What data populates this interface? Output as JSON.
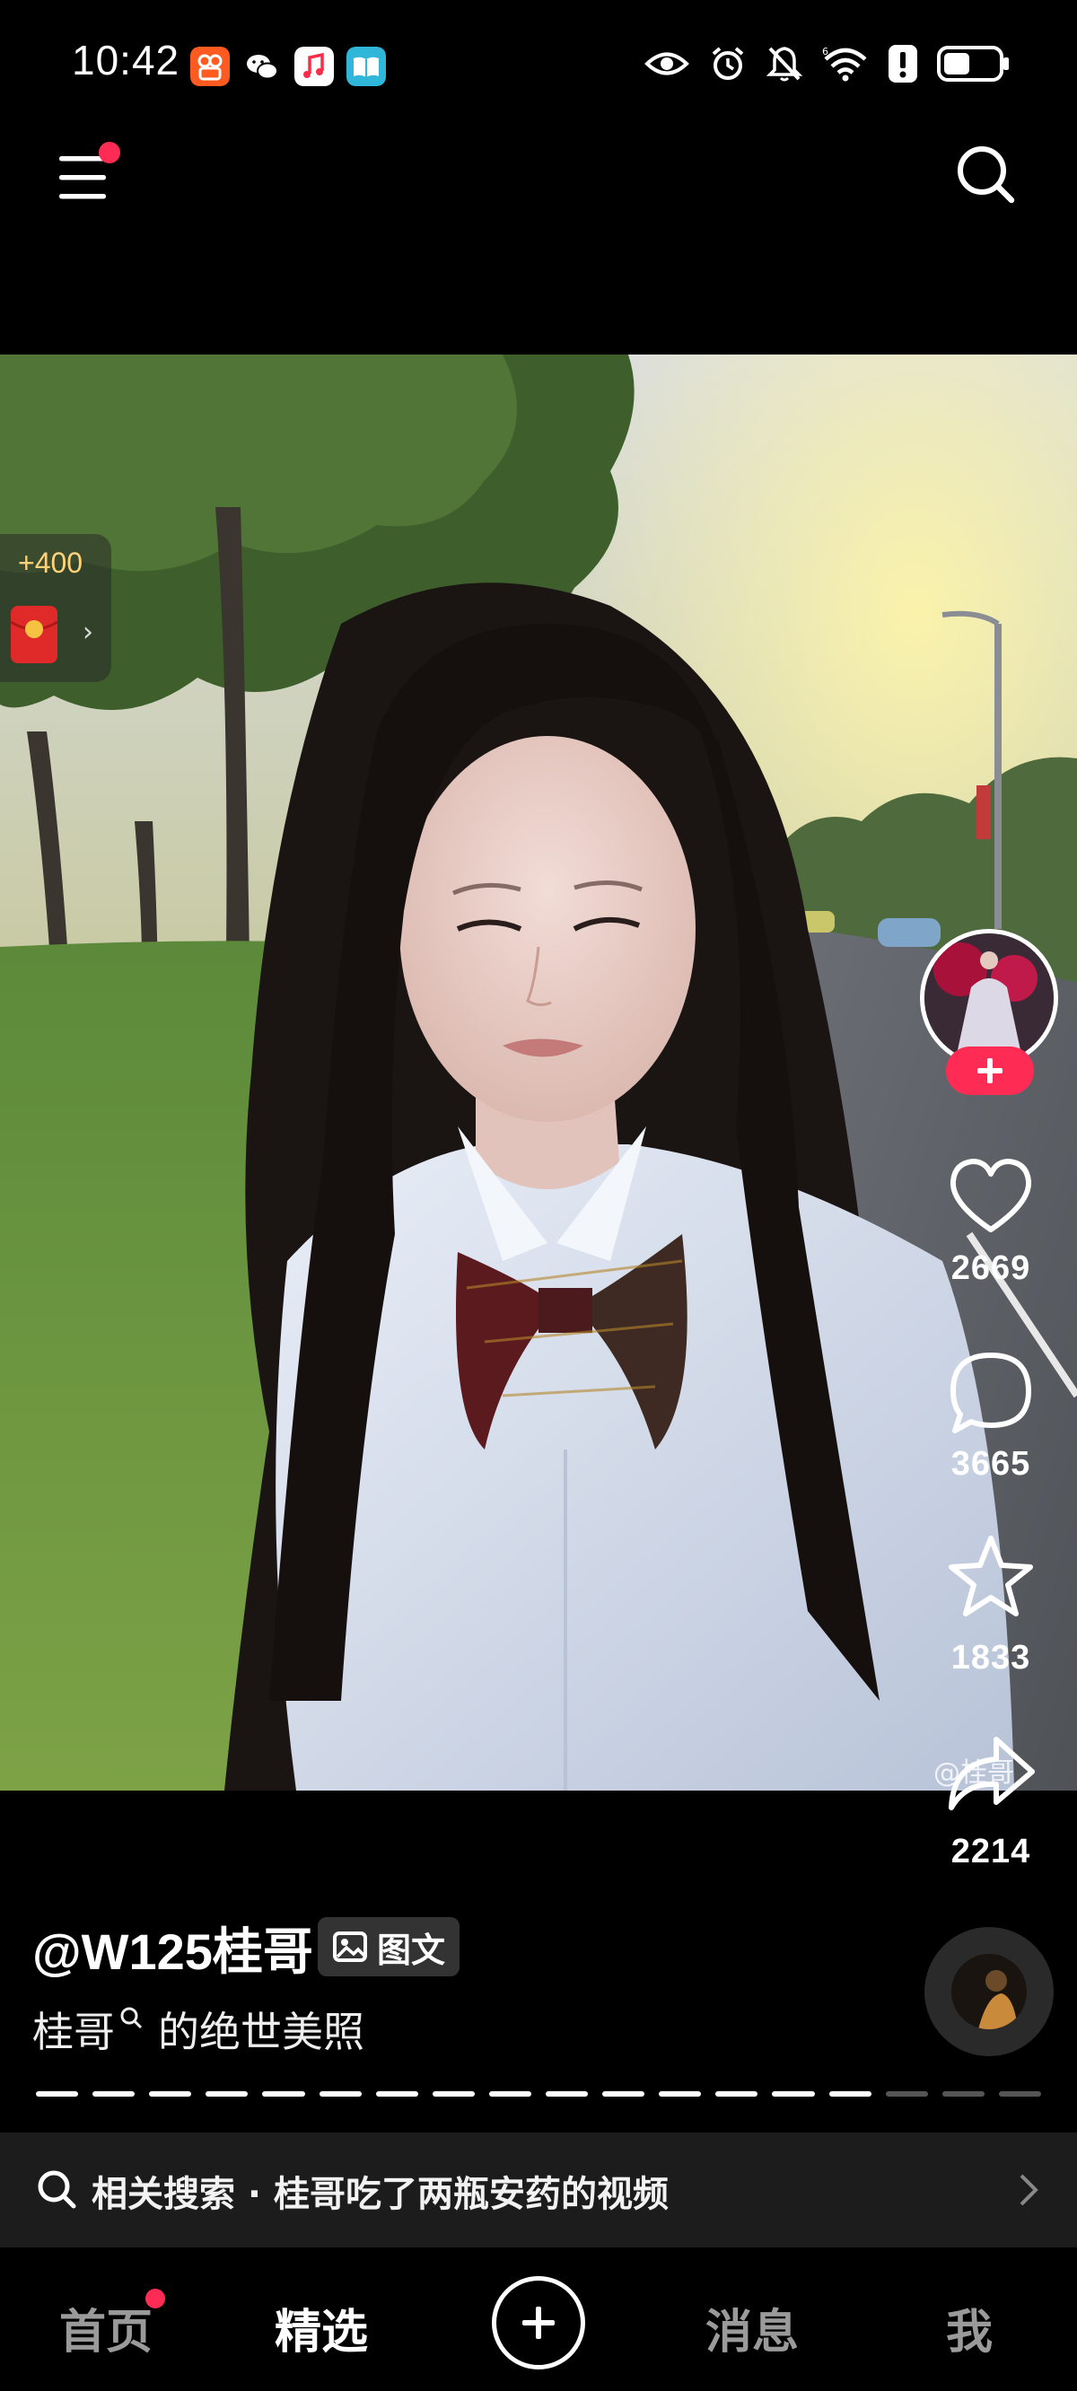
{
  "status_bar": {
    "time": "10:42",
    "app_icons": [
      "kuaishou-app-icon",
      "wechat-app-icon",
      "music-app-icon",
      "reader-app-icon"
    ],
    "status_icons": [
      "eye-comfort-icon",
      "alarm-icon",
      "mute-icon",
      "wifi-icon",
      "alert-icon",
      "battery-icon"
    ],
    "battery_level": 0.45
  },
  "top_bar": {
    "menu_icon": "menu-icon",
    "search_icon": "search-icon"
  },
  "red_packet": {
    "bonus": "+400"
  },
  "rail": {
    "like_count": "2669",
    "comment_count": "3665",
    "favorite_count": "1833",
    "share_count": "2214"
  },
  "watermark": "@桂哥",
  "post": {
    "author": "@W125桂哥",
    "type_badge": "图文",
    "caption_keyword": "桂哥",
    "caption_rest": "的绝世美照",
    "progress": {
      "total_segments": 18,
      "viewed_segments": 15
    }
  },
  "related_search": {
    "prefix": "相关搜索 · ",
    "query": "桂哥吃了两瓶安药的视频"
  },
  "bottom_nav": {
    "home": "首页",
    "featured": "精选",
    "messages": "消息",
    "me": "我"
  },
  "colors": {
    "accent": "#fe2c55",
    "background": "#000000",
    "bonus_text": "#ffd27a"
  }
}
